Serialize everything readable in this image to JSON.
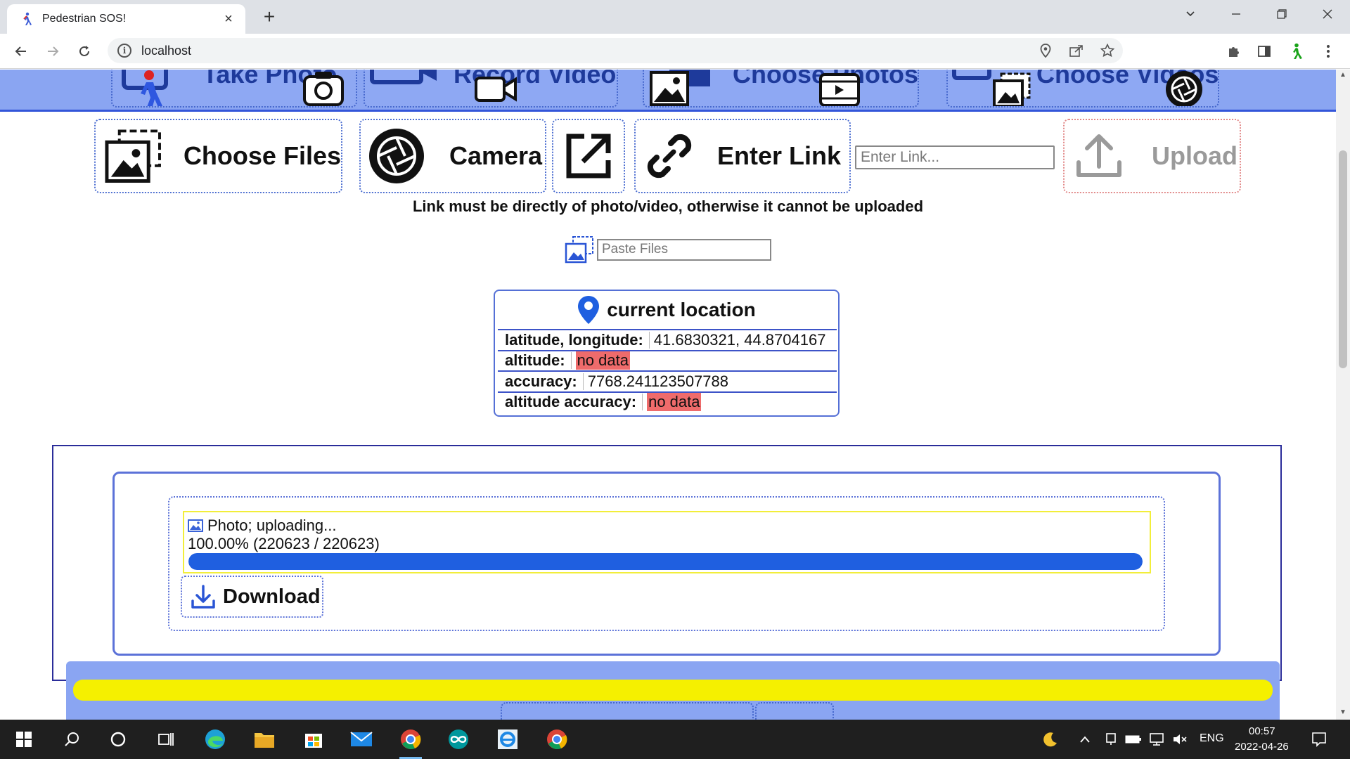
{
  "browser": {
    "tab_title": "Pedestrian SOS!",
    "url": "localhost"
  },
  "top_nav": {
    "buttons": [
      "Take Photo",
      "Record Video",
      "Choose Photos",
      "Choose Videos"
    ]
  },
  "actions": {
    "choose_files": "Choose Files",
    "camera": "Camera",
    "enter_link": "Enter Link",
    "link_placeholder": "Enter Link...",
    "upload": "Upload"
  },
  "hint": "Link must be directly of photo/video, otherwise it cannot be uploaded",
  "paste": {
    "placeholder": "Paste Files"
  },
  "location": {
    "title": "current location",
    "rows": [
      {
        "key": "latitude, longitude",
        "value": "41.6830321, 44.8704167",
        "missing": false
      },
      {
        "key": "altitude",
        "value": "no data",
        "missing": true
      },
      {
        "key": "accuracy",
        "value": "7768.241123507788",
        "missing": false
      },
      {
        "key": "altitude accuracy",
        "value": "no data",
        "missing": true
      }
    ]
  },
  "upload_item": {
    "status": "Photo; uploading...",
    "progress_text": "100.00% (220623 / 220623)",
    "progress_fraction": 1.0,
    "download_label": "Download"
  },
  "taskbar": {
    "language": "ENG",
    "time": "00:57",
    "date": "2022-04-26"
  },
  "colors": {
    "accent_blue": "#1f5fe0",
    "nav_blue": "#8aa5f2",
    "no_data_red": "#ef6b6b",
    "highlight_yellow": "#f5f000"
  }
}
